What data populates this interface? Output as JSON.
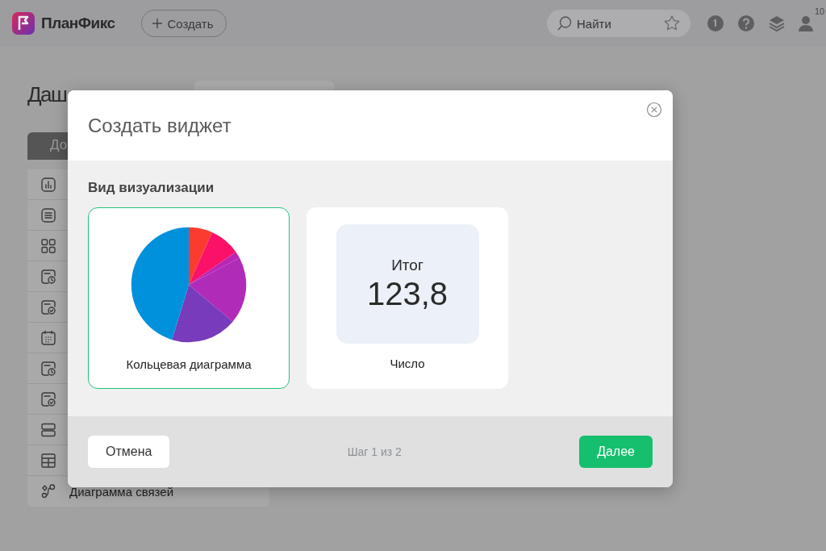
{
  "header": {
    "app_name": "ПланФикс",
    "create_button": "Создать",
    "search": {
      "placeholder": "Найти"
    },
    "notifications_count": "10"
  },
  "page": {
    "title": "Даш",
    "tab": "До",
    "items": [
      {
        "kind": "chart"
      },
      {
        "kind": "list"
      },
      {
        "kind": "grid"
      },
      {
        "kind": "calendar-clock"
      },
      {
        "kind": "calendar-check"
      },
      {
        "kind": "calendar-dots"
      },
      {
        "kind": "calendar-clock"
      },
      {
        "kind": "calendar-check"
      },
      {
        "kind": "rows"
      },
      {
        "kind": "table"
      },
      {
        "kind": "relations",
        "label": "Диаграмма связей"
      }
    ]
  },
  "dialog": {
    "title": "Создать виджет",
    "section_title": "Вид визуализации",
    "options": [
      {
        "kind": "pie",
        "label": "Кольцевая диаграмма",
        "selected": true
      },
      {
        "kind": "number",
        "label": "Число",
        "caption": "Итог",
        "value": "123,8",
        "selected": false
      }
    ],
    "cancel_button": "Отмена",
    "step": "Шаг 1 из 2",
    "next_button": "Далее"
  }
}
